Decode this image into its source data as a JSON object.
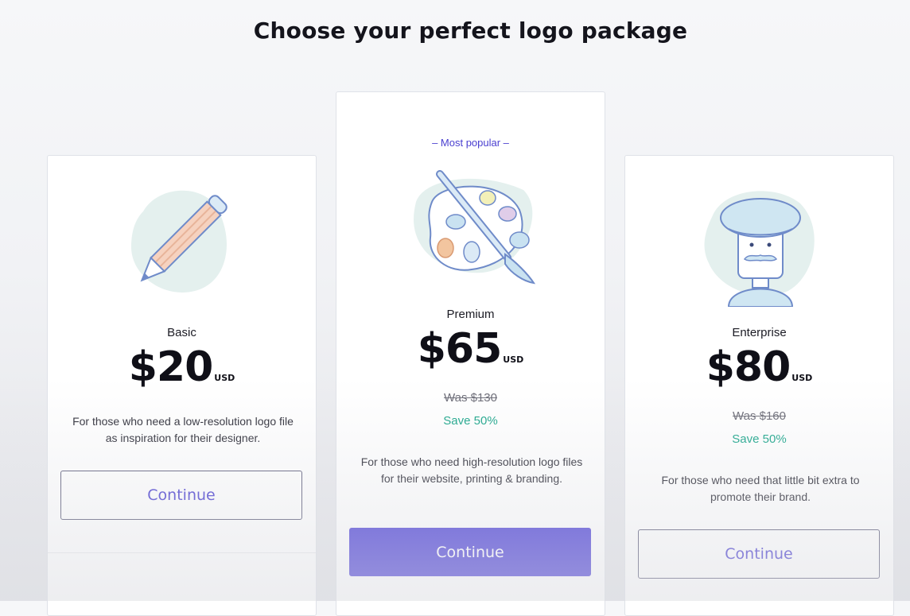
{
  "page": {
    "title": "Choose your perfect logo package"
  },
  "plans": [
    {
      "name": "Basic",
      "price": "$20",
      "currency": "USD",
      "description": "For those who need a low-resolution logo file as inspiration for their designer.",
      "button_label": "Continue",
      "illustration": "pencil-icon"
    },
    {
      "badge": "– Most popular –",
      "name": "Premium",
      "price": "$65",
      "currency": "USD",
      "was_price": "Was $130",
      "save_text": "Save 50%",
      "description": "For those who need high-resolution logo files for their website, printing & branding.",
      "button_label": "Continue",
      "illustration": "paint-palette-icon"
    },
    {
      "name": "Enterprise",
      "price": "$80",
      "currency": "USD",
      "was_price": "Was $160",
      "save_text": "Save 50%",
      "description": "For those who need that little bit extra to promote their brand.",
      "button_label": "Continue",
      "illustration": "artist-beret-icon"
    }
  ],
  "colors": {
    "accent": "#4b3fd6",
    "save_green": "#1aa58a",
    "text_dark": "#14141c"
  }
}
